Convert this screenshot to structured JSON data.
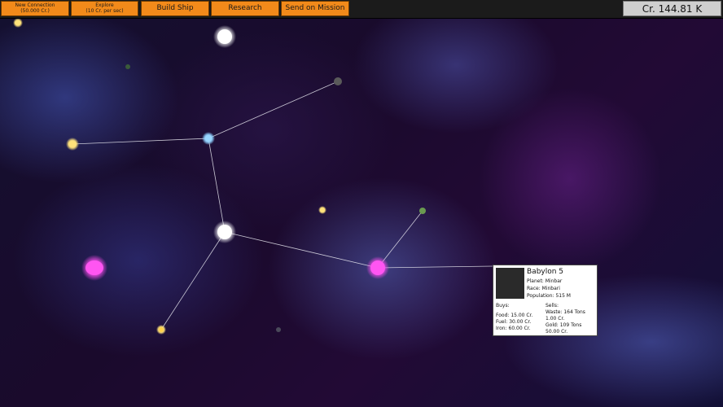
{
  "toolbar": {
    "new_connection": {
      "line1": "New Connection",
      "line2": "(50.000 Cr.)"
    },
    "explore": {
      "line1": "Explore",
      "line2": "(10 Cr. per sec)"
    },
    "build_ship": "Build Ship",
    "research": "Research",
    "send_on_mission": "Send on Mission"
  },
  "credits": "Cr. 144.81 K",
  "popup": {
    "name": "Babylon 5",
    "planet": "Planet: Minbar",
    "race": "Race: Minbari",
    "population": "Population: 515 M",
    "buys_label": "Buys:",
    "buys": [
      "Food: 15.00 Cr.",
      "Fuel: 30.00 Cr.",
      "Iron: 60.00 Cr."
    ],
    "sells_label": "Sells:",
    "sells": [
      "Waste: 164 Tons",
      "1.00 Cr.",
      "Gold: 109 Tons",
      "50.00 Cr."
    ]
  },
  "colors": {
    "button": "#f28a1a",
    "star_white": "#ffffff",
    "star_yellow": "#ffe27a",
    "star_blue": "#8fd0ff",
    "star_magenta": "#ff4df0",
    "star_gray": "#5a5a5a",
    "star_green": "#6a9a50"
  }
}
